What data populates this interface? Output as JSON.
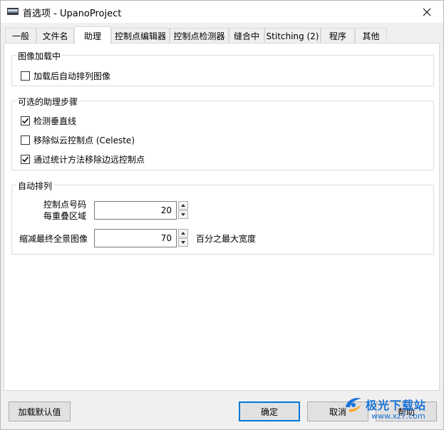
{
  "window": {
    "title": "首选项 - UpanoProject"
  },
  "tabs": [
    {
      "label": "一般"
    },
    {
      "label": "文件名"
    },
    {
      "label": "助理"
    },
    {
      "label": "控制点编辑器"
    },
    {
      "label": "控制点检测器"
    },
    {
      "label": "缝合中"
    },
    {
      "label": "Stitching (2)"
    },
    {
      "label": "程序"
    },
    {
      "label": "其他"
    }
  ],
  "groups": {
    "loading": {
      "title": "图像加载中",
      "auto_align": {
        "label": "加载后自动排列图像",
        "checked": false
      }
    },
    "optional_steps": {
      "title": "可选的助理步骤",
      "detect_vertical": {
        "label": "检测垂直线",
        "checked": true
      },
      "remove_cloud": {
        "label": "移除似云控制点 (Celeste)",
        "checked": false
      },
      "remove_edge": {
        "label": "通过统计方法移除边远控制点",
        "checked": true
      }
    },
    "auto_align": {
      "title": "自动排列",
      "cp_label_line1": "控制点号码",
      "cp_label_line2": "每重叠区域",
      "cp_value": "20",
      "scale_label": "缩减最终全景图像",
      "scale_value": "70",
      "scale_suffix": "百分之最大宽度"
    }
  },
  "buttons": {
    "load_defaults": "加载默认值",
    "ok": "确定",
    "cancel": "取消",
    "help": "帮助"
  },
  "watermark": {
    "text": "极光下载站",
    "url": "www.xz7.com"
  },
  "colors": {
    "check": "#000000",
    "default_border": "#0078d7",
    "watermark_blue": "#1a73d9"
  }
}
